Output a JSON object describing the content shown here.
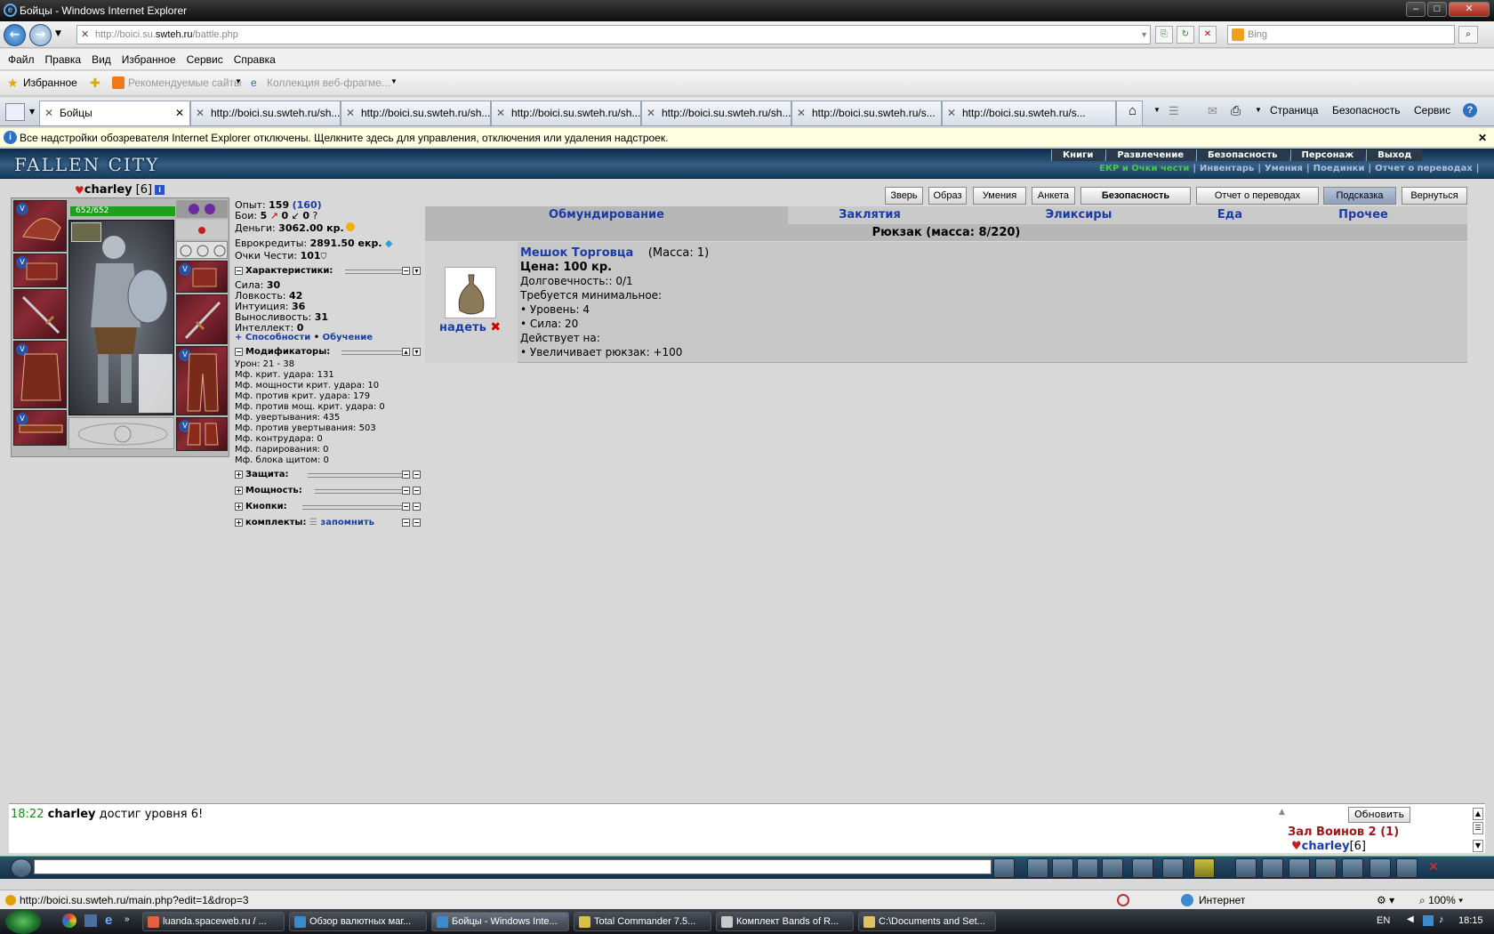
{
  "window": {
    "title": "Бойцы - Windows Internet Explorer"
  },
  "address": {
    "host": "http://boici.su.",
    "domain": "swteh.ru",
    "path": "/battle.php",
    "search_placeholder": "Bing"
  },
  "menu": [
    "Файл",
    "Правка",
    "Вид",
    "Избранное",
    "Сервис",
    "Справка"
  ],
  "favorites": {
    "label": "Избранное",
    "recommended": "Рекомендуемые сайты",
    "gallery": "Коллекция веб-фрагме..."
  },
  "browser_tabs": [
    {
      "label": "Бойцы",
      "active": true
    },
    {
      "label": "http://boici.su.swteh.ru/sh..."
    },
    {
      "label": "http://boici.su.swteh.ru/sh..."
    },
    {
      "label": "http://boici.su.swteh.ru/sh..."
    },
    {
      "label": "http://boici.su.swteh.ru/sh..."
    },
    {
      "label": "http://boici.su.swteh.ru/s..."
    },
    {
      "label": "http://boici.su.swteh.ru/s..."
    }
  ],
  "command_bar": {
    "page": "Страница",
    "safety": "Безопасность",
    "tools": "Сервис"
  },
  "infobar": "Все надстройки обозревателя Internet Explorer отключены. Щелкните здесь для управления, отключения или удаления надстроек.",
  "game": {
    "logo": "FALLEN CITY",
    "top_nav": [
      "Книги",
      "Развлечение",
      "Безопасность",
      "Персонаж",
      "Выход"
    ],
    "sub_nav": [
      "ЕКР и Очки чести",
      "Инвентарь",
      "Умения",
      "Поединки",
      "Отчет о переводах"
    ],
    "character": {
      "name": "charley",
      "level": "[6]",
      "hp": "652/652",
      "hp_fraction": 1.0,
      "exp_label": "Опыт:",
      "exp": "159",
      "exp_next": "(160)",
      "fights_label": "Бои:",
      "fights": "5",
      "fights_b": "0",
      "fights_c": "0",
      "fights_d": "?",
      "money_label": "Деньги:",
      "money": "3062.00 кр.",
      "euro_label": "Еврокредиты:",
      "euro": "2891.50 екр.",
      "honor_label": "Очки Чести:",
      "honor": "101"
    },
    "stats": {
      "header": "Характеристики:",
      "items": [
        {
          "label": "Сила:",
          "value": "30"
        },
        {
          "label": "Ловкость:",
          "value": "42"
        },
        {
          "label": "Интуиция:",
          "value": "36"
        },
        {
          "label": "Выносливость:",
          "value": "31"
        },
        {
          "label": "Интеллект:",
          "value": "0"
        }
      ],
      "abilities": "+ Способности",
      "training": "Обучение"
    },
    "modifiers": {
      "header": "Модификаторы:",
      "items": [
        "Урон: 21 - 38",
        "Мф. крит. удара: 131",
        "Мф. мощности крит. удара: 10",
        "Мф. против крит. удара: 179",
        "Мф. против мощ. крит. удара: 0",
        "Мф. увертывания: 435",
        "Мф. против увертывания: 503",
        "Мф. контрудара: 0",
        "Мф. парирования: 0",
        "Мф. блока щитом: 0"
      ]
    },
    "sections": [
      "Защита:",
      "Мощность:",
      "Кнопки:",
      "комплекты:"
    ],
    "remember": "запомнить",
    "buttons": [
      "Зверь",
      "Образ",
      "Умения",
      "Анкета",
      "Безопасность",
      "Отчет о переводах",
      "Подсказка",
      "Вернуться"
    ],
    "inv_tabs": [
      "Обмундирование",
      "Заклятия",
      "Эликсиры",
      "Еда",
      "Прочее"
    ],
    "backpack": "Рюкзак (масса: 8/220)",
    "item": {
      "name": "Мешок Торговца",
      "mass": "(Масса: 1)",
      "price": "Цена: 100 кр.",
      "durability": "Долговечность:: 0/1",
      "req": "Требуется минимальное:",
      "req1": "• Уровень: 4",
      "req2": "• Сила: 20",
      "acts": "Действует на:",
      "effect": "• Увеличивает рюкзак: +100",
      "wear": "надеть"
    },
    "chat": {
      "time": "18:22",
      "user": "charley",
      "message": "достиг уровня 6!",
      "refresh": "Обновить",
      "room": "Зал Воинов 2 (1)",
      "online_user": "charley",
      "online_level": "[6]"
    }
  },
  "status": {
    "url": "http://boici.su.swteh.ru/main.php?edit=1&drop=3",
    "zone": "Интернет",
    "zoom": "100%"
  },
  "taskbar": {
    "tasks": [
      "luanda.spaceweb.ru / ...",
      "Обзор валютных маг...",
      "Бойцы - Windows Inte...",
      "Total Commander 7.5...",
      "Комплект Bands of R...",
      "C:\\Documents and Set..."
    ],
    "lang": "EN",
    "time": "18:15"
  }
}
